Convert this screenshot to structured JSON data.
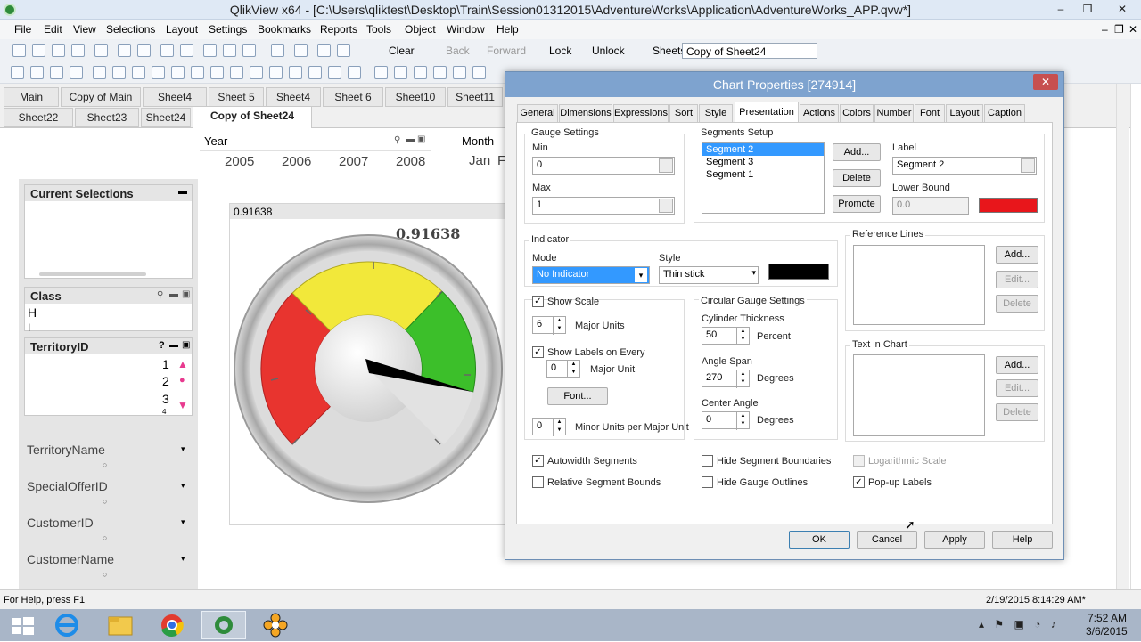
{
  "window": {
    "title": "QlikView x64 - [C:\\Users\\qliktest\\Desktop\\Train\\Session01312015\\AdventureWorks\\Application\\AdventureWorks_APP.qvw*]",
    "min": "–",
    "restore": "❐",
    "close": "✕",
    "inner_min": "–",
    "inner_restore": "❐",
    "inner_close": "✕"
  },
  "menu": [
    "File",
    "Edit",
    "View",
    "Selections",
    "Layout",
    "Settings",
    "Bookmarks",
    "Reports",
    "Tools",
    "Object",
    "Window",
    "Help"
  ],
  "toolbar": {
    "clear": "Clear",
    "back": "Back",
    "forward": "Forward",
    "lock": "Lock",
    "unlock": "Unlock",
    "sheets_label": "Sheets",
    "sheets_value": "Copy of Sheet24"
  },
  "sheet_tabs_row1": [
    "Main",
    "Copy of Main",
    "Sheet4",
    "Sheet 5",
    "Sheet4",
    "Sheet 6",
    "Sheet10",
    "Sheet11"
  ],
  "sheet_tabs_row2": [
    "Sheet22",
    "Sheet23",
    "Sheet24",
    "Copy of Sheet24"
  ],
  "year": {
    "title": "Year",
    "values": [
      "2005",
      "2006",
      "2007",
      "2008"
    ]
  },
  "month": {
    "title": "Month",
    "values": [
      "Jan",
      "F"
    ]
  },
  "current_selections": {
    "title": "Current Selections"
  },
  "class_box": {
    "title": "Class",
    "values": [
      "H",
      "I"
    ]
  },
  "territory": {
    "title": "TerritoryID",
    "values": [
      "1",
      "2",
      "3",
      "4"
    ],
    "help": "?"
  },
  "fields": [
    "TerritoryName",
    "SpecialOfferID",
    "CustomerID",
    "CustomerName"
  ],
  "gauge": {
    "caption": "0.91638",
    "value_label": "0.91638",
    "value": 0.91638,
    "min": 0,
    "max": 1,
    "colors": {
      "red": "#e8342f",
      "yellow": "#f2e83a",
      "green": "#3cbf2a"
    }
  },
  "dialog": {
    "title": "Chart Properties [274914]",
    "tabs": [
      "General",
      "Dimensions",
      "Expressions",
      "Sort",
      "Style",
      "Presentation",
      "Actions",
      "Colors",
      "Number",
      "Font",
      "Layout",
      "Caption"
    ],
    "gauge_settings": {
      "title": "Gauge Settings",
      "min_label": "Min",
      "min_value": "0",
      "max_label": "Max",
      "max_value": "1"
    },
    "segments": {
      "title": "Segments Setup",
      "items": [
        "Segment 2",
        "Segment 3",
        "Segment 1"
      ],
      "add": "Add...",
      "delete": "Delete",
      "promote": "Promote",
      "label_title": "Label",
      "label_value": "Segment 2",
      "lower_bound_title": "Lower Bound",
      "lower_bound_value": "0.0",
      "color": "#e8161b"
    },
    "indicator": {
      "title": "Indicator",
      "mode_label": "Mode",
      "mode_value": "No Indicator",
      "style_label": "Style",
      "style_value": "Thin stick",
      "color": "#000000"
    },
    "scale": {
      "show_scale": "Show Scale",
      "major_units_value": "6",
      "major_units_label": "Major Units",
      "show_labels": "Show Labels on Every",
      "labels_every_value": "0",
      "major_unit_label": "Major Unit",
      "font": "Font...",
      "minor_value": "0",
      "minor_label": "Minor Units per Major Unit"
    },
    "circular": {
      "title": "Circular Gauge Settings",
      "cyl_label": "Cylinder Thickness",
      "cyl_value": "50",
      "cyl_unit": "Percent",
      "span_label": "Angle Span",
      "span_value": "270",
      "span_unit": "Degrees",
      "center_label": "Center Angle",
      "center_value": "0",
      "center_unit": "Degrees"
    },
    "reference_lines": {
      "title": "Reference Lines",
      "add": "Add...",
      "edit": "Edit...",
      "delete": "Delete"
    },
    "text_in_chart": {
      "title": "Text in Chart",
      "add": "Add...",
      "edit": "Edit...",
      "delete": "Delete"
    },
    "checks": {
      "autowidth": "Autowidth Segments",
      "relative": "Relative Segment Bounds",
      "hide_bounds": "Hide Segment Boundaries",
      "hide_outlines": "Hide Gauge Outlines",
      "log": "Logarithmic Scale",
      "popup": "Pop-up Labels"
    },
    "buttons": {
      "ok": "OK",
      "cancel": "Cancel",
      "apply": "Apply",
      "help": "Help"
    }
  },
  "status": {
    "left": "For Help, press F1",
    "right": "2/19/2015 8:14:29 AM*"
  },
  "taskbar": {
    "time": "7:52 AM",
    "date": "3/6/2015"
  }
}
